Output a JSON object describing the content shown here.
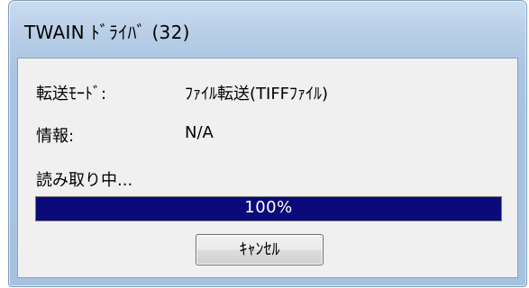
{
  "window": {
    "title": "TWAIN ﾄﾞﾗｲﾊﾞ (32)"
  },
  "fields": {
    "transfer_mode_label": "転送ﾓｰﾄﾞ:",
    "transfer_mode_value": "ﾌｧｲﾙ転送(TIFFﾌｧｲﾙ)",
    "info_label": "情報:",
    "info_value": "N/A"
  },
  "status": {
    "text": "読み取り中...",
    "progress_percent": 100,
    "progress_label": "100%"
  },
  "buttons": {
    "cancel_label": "ｷｬﾝｾﾙ"
  },
  "colors": {
    "progress_fill": "#0a0a7a",
    "client_bg": "#f0f0f0"
  }
}
